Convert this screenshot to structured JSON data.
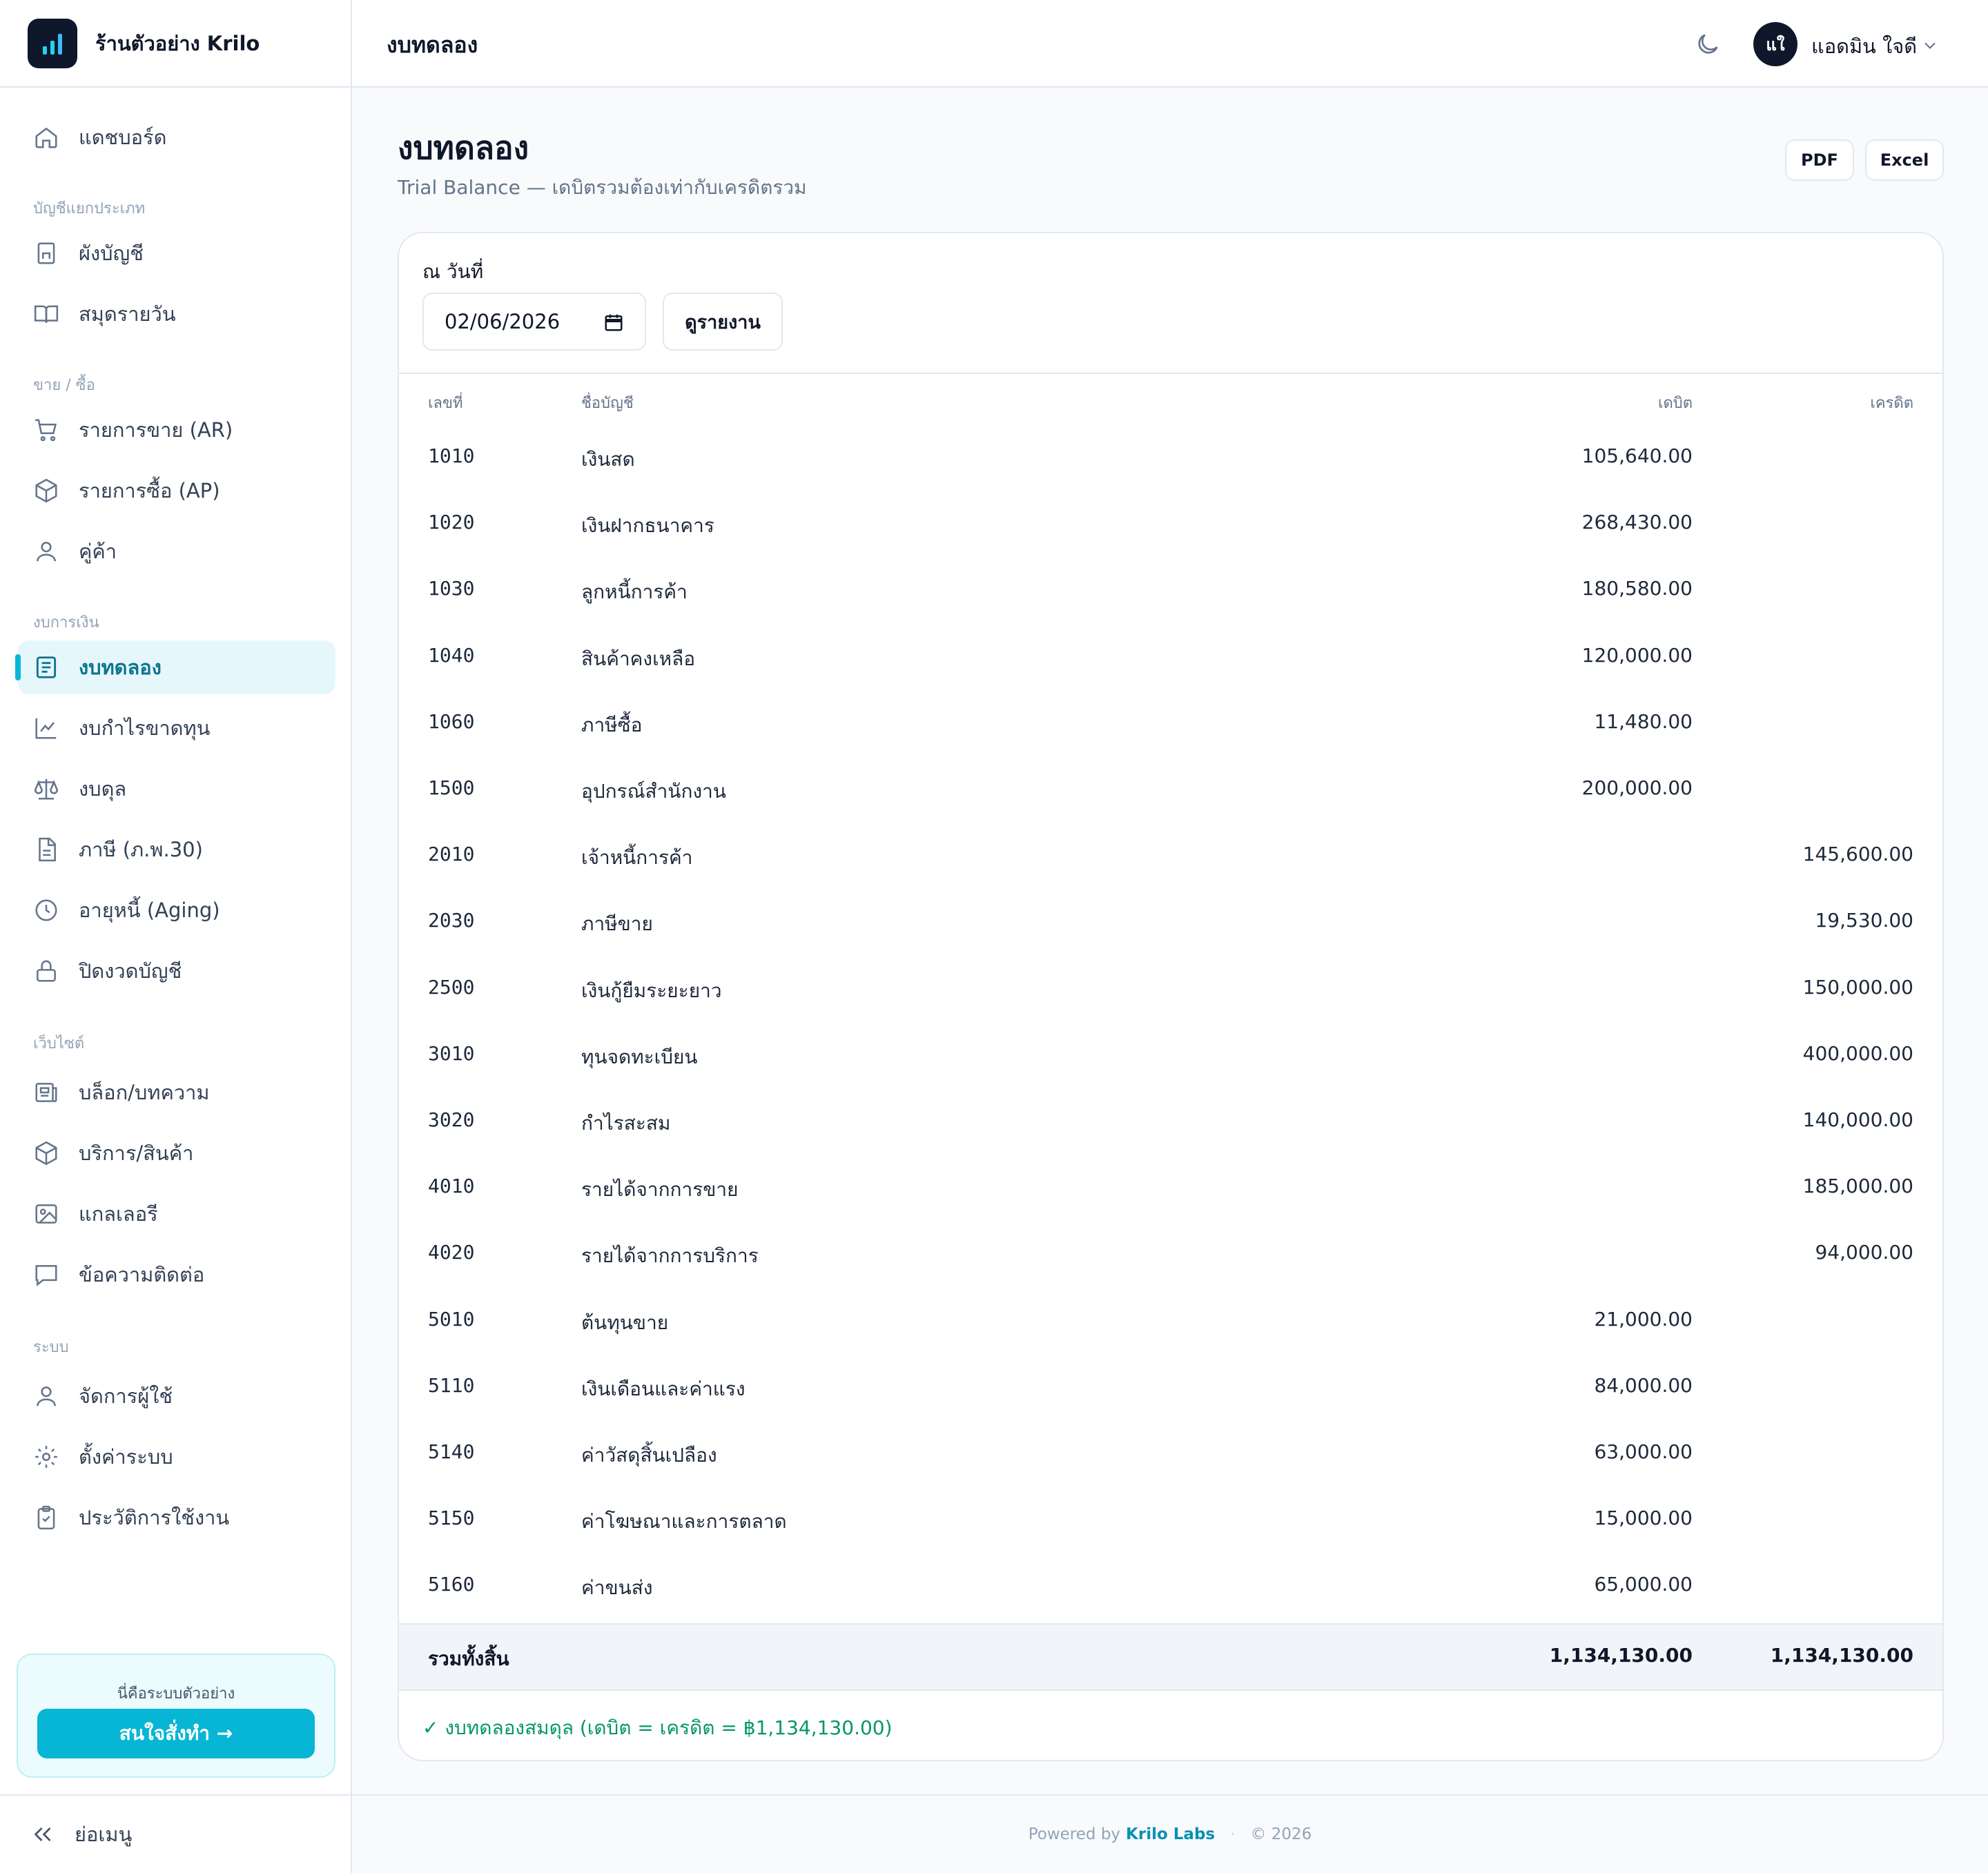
{
  "app": {
    "name": "ร้านตัวอย่าง Krilo"
  },
  "topbar": {
    "title": "งบทดลอง",
    "user_initials": "แใ",
    "user_name": "แอดมิน ใจดี"
  },
  "sidebar": {
    "dashboard": "แดชบอร์ด",
    "sections": {
      "ledger": "บัญชีแยกประเภท",
      "trade": "ขาย / ซื้อ",
      "finance": "งบการเงิน",
      "website": "เว็บไซต์",
      "system": "ระบบ"
    },
    "items": {
      "chart_of_accounts": "ผังบัญชี",
      "journal": "สมุดรายวัน",
      "sales_ar": "รายการขาย (AR)",
      "purchases_ap": "รายการซื้อ (AP)",
      "contacts": "คู่ค้า",
      "trial_balance": "งบทดลอง",
      "profit_loss": "งบกำไรขาดทุน",
      "balance_sheet": "งบดุล",
      "tax": "ภาษี (ภ.พ.30)",
      "aging": "อายุหนี้ (Aging)",
      "close_period": "ปิดงวดบัญชี",
      "blog": "บล็อก/บทความ",
      "services": "บริการ/สินค้า",
      "gallery": "แกลเลอรี",
      "messages": "ข้อความติดต่อ",
      "users": "จัดการผู้ใช้",
      "settings": "ตั้งค่าระบบ",
      "history": "ประวัติการใช้งาน"
    },
    "demo_text": "นี่คือระบบตัวอย่าง",
    "demo_button": "สนใจสั่งทำ →",
    "collapse": "ย่อเมนู"
  },
  "page": {
    "title": "งบทดลอง",
    "subtitle": "Trial Balance — เดบิตรวมต้องเท่ากับเครดิตรวม",
    "pdf": "PDF",
    "excel": "Excel"
  },
  "filter": {
    "date_label": "ณ วันที่",
    "date_value": "02/06/2026",
    "view_button": "ดูรายงาน"
  },
  "table": {
    "headers": {
      "no": "เลขที่",
      "name": "ชื่อบัญชี",
      "debit": "เดบิต",
      "credit": "เครดิต"
    },
    "rows": [
      {
        "no": "1010",
        "name": "เงินสด",
        "debit": "105,640.00",
        "credit": ""
      },
      {
        "no": "1020",
        "name": "เงินฝากธนาคาร",
        "debit": "268,430.00",
        "credit": ""
      },
      {
        "no": "1030",
        "name": "ลูกหนี้การค้า",
        "debit": "180,580.00",
        "credit": ""
      },
      {
        "no": "1040",
        "name": "สินค้าคงเหลือ",
        "debit": "120,000.00",
        "credit": ""
      },
      {
        "no": "1060",
        "name": "ภาษีซื้อ",
        "debit": "11,480.00",
        "credit": ""
      },
      {
        "no": "1500",
        "name": "อุปกรณ์สำนักงาน",
        "debit": "200,000.00",
        "credit": ""
      },
      {
        "no": "2010",
        "name": "เจ้าหนี้การค้า",
        "debit": "",
        "credit": "145,600.00"
      },
      {
        "no": "2030",
        "name": "ภาษีขาย",
        "debit": "",
        "credit": "19,530.00"
      },
      {
        "no": "2500",
        "name": "เงินกู้ยืมระยะยาว",
        "debit": "",
        "credit": "150,000.00"
      },
      {
        "no": "3010",
        "name": "ทุนจดทะเบียน",
        "debit": "",
        "credit": "400,000.00"
      },
      {
        "no": "3020",
        "name": "กำไรสะสม",
        "debit": "",
        "credit": "140,000.00"
      },
      {
        "no": "4010",
        "name": "รายได้จากการขาย",
        "debit": "",
        "credit": "185,000.00"
      },
      {
        "no": "4020",
        "name": "รายได้จากการบริการ",
        "debit": "",
        "credit": "94,000.00"
      },
      {
        "no": "5010",
        "name": "ต้นทุนขาย",
        "debit": "21,000.00",
        "credit": ""
      },
      {
        "no": "5110",
        "name": "เงินเดือนและค่าแรง",
        "debit": "84,000.00",
        "credit": ""
      },
      {
        "no": "5140",
        "name": "ค่าวัสดุสิ้นเปลือง",
        "debit": "63,000.00",
        "credit": ""
      },
      {
        "no": "5150",
        "name": "ค่าโฆษณาและการตลาด",
        "debit": "15,000.00",
        "credit": ""
      },
      {
        "no": "5160",
        "name": "ค่าขนส่ง",
        "debit": "65,000.00",
        "credit": ""
      }
    ],
    "total": {
      "label": "รวมทั้งสิ้น",
      "debit": "1,134,130.00",
      "credit": "1,134,130.00"
    },
    "balanced_note": "✓ งบทดลองสมดุล (เดบิต = เครดิต = ฿1,134,130.00)"
  },
  "footer": {
    "powered_by": "Powered by",
    "brand": "Krilo Labs",
    "separator": "·",
    "copyright": "© 2026"
  },
  "colors": {
    "accent": "#06b6d4",
    "accent_dark": "#0e7490",
    "success": "#059669"
  }
}
